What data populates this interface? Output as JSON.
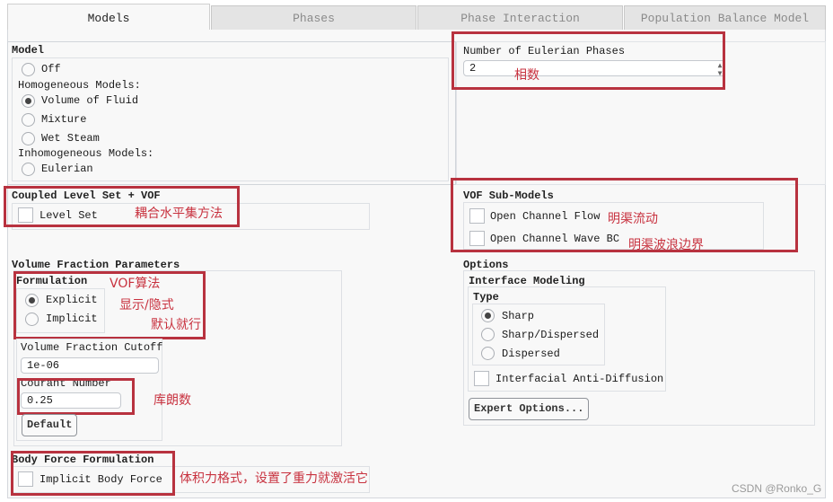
{
  "tabs": [
    {
      "label": "Models",
      "active": true
    },
    {
      "label": "Phases",
      "active": false
    },
    {
      "label": "Phase Interaction",
      "active": false
    },
    {
      "label": "Population Balance Model",
      "active": false
    }
  ],
  "model": {
    "title": "Model",
    "off_label": "Off",
    "homogeneous_label": "Homogeneous Models:",
    "vof_label": "Volume of Fluid",
    "mixture_label": "Mixture",
    "wet_steam_label": "Wet Steam",
    "inhomogeneous_label": "Inhomogeneous Models:",
    "eulerian_label": "Eulerian",
    "selected": "Volume of Fluid"
  },
  "eulerian_phases": {
    "label": "Number of Eulerian Phases",
    "value": "2",
    "note": "相数"
  },
  "coupled_level_set": {
    "title": "Coupled Level Set + VOF",
    "level_set_label": "Level Set",
    "level_set_checked": false,
    "note": "耦合水平集方法"
  },
  "vof_sub_models": {
    "title": "VOF Sub-Models",
    "open_channel_flow_label": "Open Channel Flow",
    "open_channel_flow_checked": false,
    "open_channel_wave_label": "Open Channel Wave BC",
    "open_channel_wave_checked": false,
    "note_flow": "明渠流动",
    "note_wave": "明渠波浪边界"
  },
  "volume_fraction": {
    "title": "Volume Fraction Parameters",
    "formulation_title": "Formulation",
    "explicit_label": "Explicit",
    "implicit_label": "Implicit",
    "selected": "Explicit",
    "note_vof": "VOF算法",
    "note_explicit": "显示/隐式",
    "note_default": "默认就行",
    "cutoff_label": "Volume Fraction Cutoff",
    "cutoff_value": "1e-06",
    "courant_label": "Courant Number",
    "courant_value": "0.25",
    "courant_note": "库朗数",
    "default_button": "Default"
  },
  "options": {
    "title": "Options",
    "interface_title": "Interface Modeling",
    "type_title": "Type",
    "sharp_label": "Sharp",
    "sharp_dispersed_label": "Sharp/Dispersed",
    "dispersed_label": "Dispersed",
    "selected": "Sharp",
    "anti_diffusion_label": "Interfacial Anti-Diffusion",
    "anti_diffusion_checked": false,
    "expert_button": "Expert Options..."
  },
  "body_force": {
    "title": "Body Force Formulation",
    "implicit_label": "Implicit Body Force",
    "checked": false,
    "note": "体积力格式，设置了重力就激活它"
  },
  "watermark": "CSDN @Ronko_G",
  "colors": {
    "annotation": "#b8323f",
    "panel_bg": "#f8f8f8",
    "tab_inactive": "#e4e4e4"
  }
}
